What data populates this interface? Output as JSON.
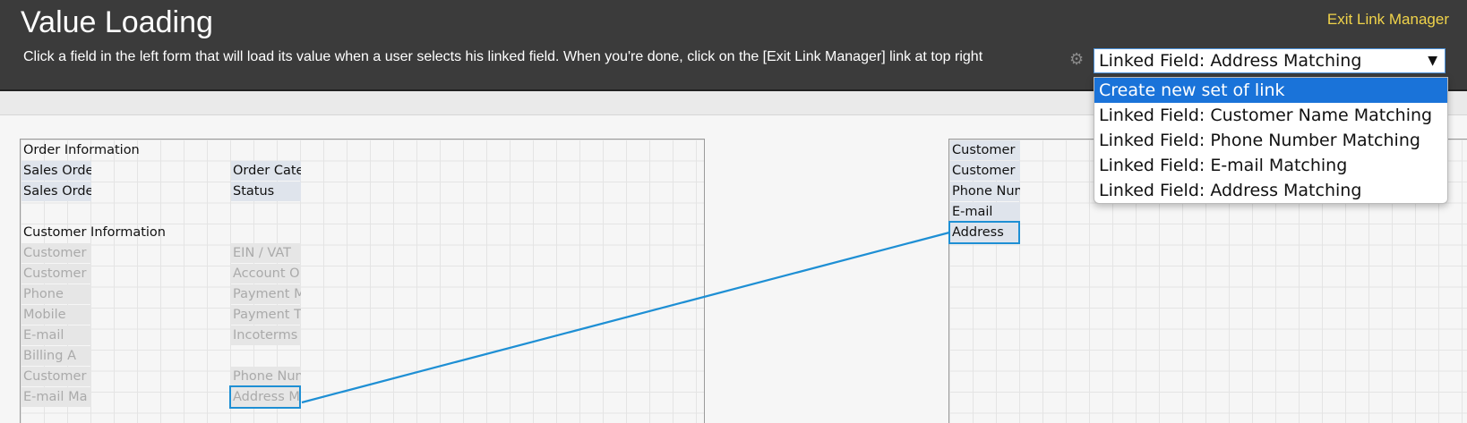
{
  "header": {
    "title": "Value Loading",
    "subtitle": "Click a field in the left form that will load its value when a user selects his linked field. When you're done, click on the [Exit Link Manager] link at top right",
    "exit_link": "Exit Link Manager"
  },
  "link_select": {
    "value": "Linked Field: Address Matching",
    "options": [
      "Create new set of link",
      "Linked Field: Customer Name Matching",
      "Linked Field: Phone Number Matching",
      "Linked Field: E-mail Matching",
      "Linked Field: Address Matching"
    ],
    "highlighted_index": 0
  },
  "left_form": {
    "order_heading": "Order Information",
    "sales_order_no": "Sales Order #",
    "order_category": "Order Category",
    "sales_order_date": "Sales Order Date",
    "status": "Status",
    "customer_heading": "Customer Information",
    "customer_1": "Customer",
    "ein_vat": "EIN / VAT",
    "customer_2": "Customer",
    "account_o": "Account O",
    "phone": "Phone",
    "payment_m": "Payment M",
    "mobile": "Mobile",
    "payment_t": "Payment T",
    "email": "E-mail",
    "incoterms": "Incoterms",
    "billing_a": "Billing A",
    "customer_3": "Customer",
    "phone_num": "Phone Num",
    "email_ma": "E-mail Ma",
    "address_m": "Address M"
  },
  "right_form": {
    "customer_id": "Customer ID",
    "customer_name": "Customer Name",
    "phone_number": "Phone Number",
    "email": "E-mail",
    "address": "Address"
  },
  "colors": {
    "header_bg": "#3b3b3b",
    "exit_link": "#f0d34a",
    "link_line": "#1e8fd4",
    "option_selected": "#1a73d9"
  }
}
